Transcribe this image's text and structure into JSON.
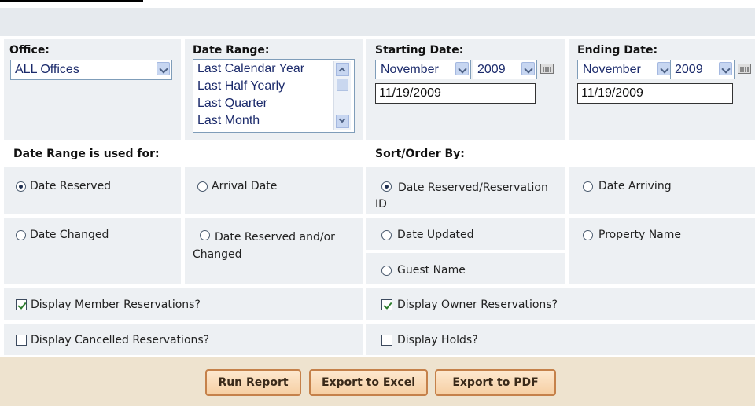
{
  "filters": {
    "office_label": "Office:",
    "office_value": "ALL Offices",
    "date_range_label": "Date Range:",
    "date_range_options": [
      "Last Calendar Year",
      "Last Half Yearly",
      "Last Quarter",
      "Last Month"
    ],
    "starting_label": "Starting Date:",
    "starting_month": "November",
    "starting_year": "2009",
    "starting_date": "11/19/2009",
    "ending_label": "Ending Date:",
    "ending_month": "November",
    "ending_year": "2009",
    "ending_date": "11/19/2009"
  },
  "date_range_used_for": {
    "header": "Date Range is used for:",
    "options": [
      "Date Reserved",
      "Arrival Date",
      "Date Changed",
      "Date Reserved and/or Changed"
    ],
    "selected": "Date Reserved"
  },
  "sort_order": {
    "header": "Sort/Order By:",
    "options": [
      "Date Reserved/Reservation ID",
      "Date Arriving",
      "Date Updated",
      "Property Name",
      "Guest Name"
    ],
    "selected": "Date Reserved/Reservation ID"
  },
  "checkboxes": {
    "member": {
      "label": "Display Member Reservations?",
      "checked": true
    },
    "owner": {
      "label": "Display Owner Reservations?",
      "checked": true
    },
    "cancelled": {
      "label": "Display Cancelled Reservations?",
      "checked": false
    },
    "holds": {
      "label": "Display Holds?",
      "checked": false
    }
  },
  "buttons": {
    "run_report": "Run Report",
    "export_excel": "Export to Excel",
    "export_pdf": "Export to PDF"
  },
  "icons": {
    "calendar": "calendar-icon",
    "dropdown": "chevron-down-icon",
    "scroll_up": "arrow-up-icon",
    "scroll_down": "arrow-down-icon"
  }
}
